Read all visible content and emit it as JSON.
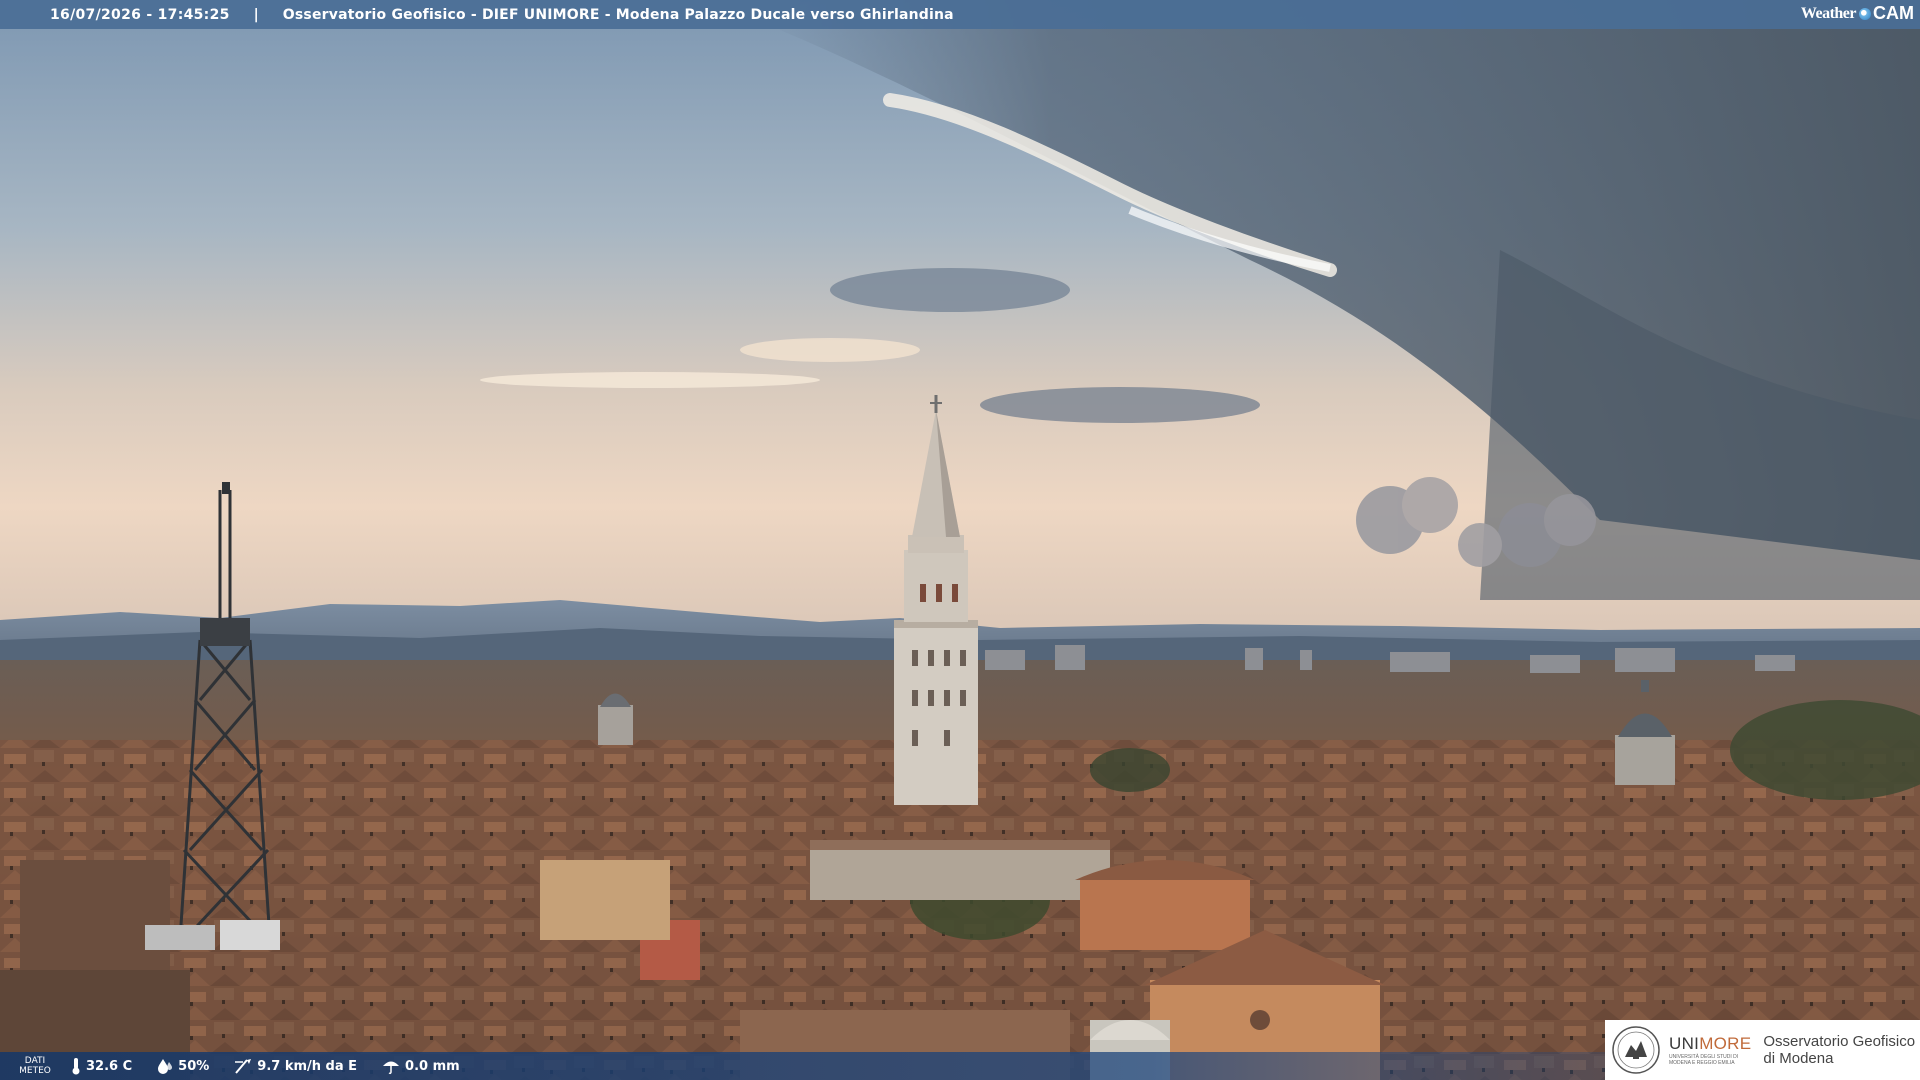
{
  "header": {
    "timestamp": "16/07/2026 - 17:45:25",
    "separator": "|",
    "title": "Osservatorio Geofisico - DIEF UNIMORE - Modena Palazzo Ducale verso Ghirlandina"
  },
  "logo": {
    "weather": "Weather",
    "cam": "CAM"
  },
  "weather_data": {
    "label_line1": "DATI",
    "label_line2": "METEO",
    "temperature": "32.6 C",
    "humidity": "50%",
    "wind": "9.7 km/h da E",
    "rain": "0.0 mm"
  },
  "institution": {
    "name_uni": "UNI",
    "name_more": "MORE",
    "subtitle": "UNIVERSITÀ DEGLI STUDI DI MODENA E REGGIO EMILIA",
    "observatory_line1": "Osservatorio Geofisico",
    "observatory_line2": "di Modena"
  },
  "colors": {
    "header_bar": "#4a6e96",
    "bottom_bar": "#143769",
    "accent_more": "#c06a3a"
  }
}
